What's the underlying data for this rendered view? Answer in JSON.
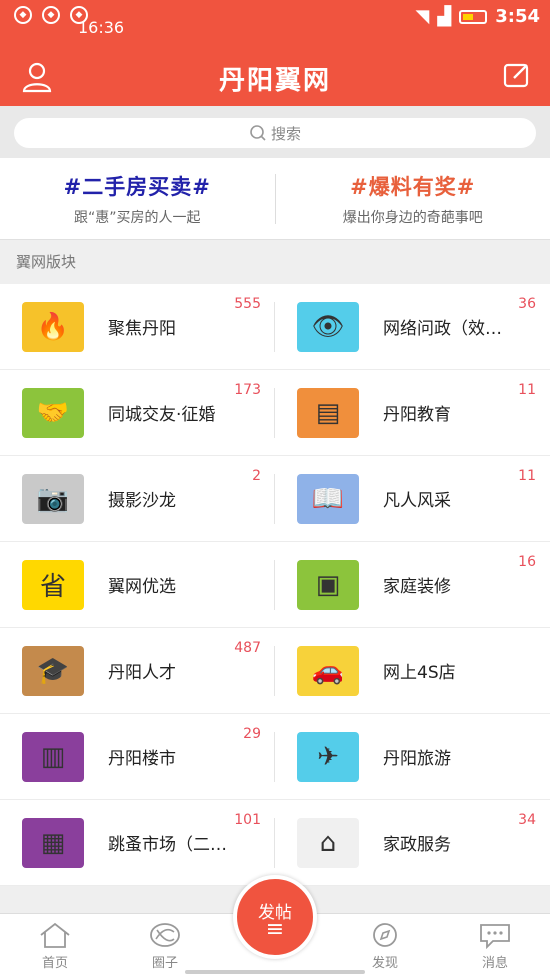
{
  "status_bar": {
    "time_left": "16:36",
    "time_right": "3:54"
  },
  "header": {
    "title": "丹阳翼网"
  },
  "search": {
    "placeholder": "搜索"
  },
  "topics": [
    {
      "title": "#二手房买卖#",
      "subtitle": "跟“惠”买房的人一起",
      "color": "#2222aa"
    },
    {
      "title": "#爆料有奖#",
      "subtitle": "爆出你身边的奇葩事吧",
      "color": "#e8603c"
    }
  ],
  "section_label": "翼网版块",
  "boards": [
    {
      "name": "聚焦丹阳",
      "count": "555",
      "icon": "phoenix-icon",
      "bg": "#f6c22a"
    },
    {
      "name": "网络问政（效…",
      "count": "36",
      "icon": "eye-icon",
      "bg": "#54cdea"
    },
    {
      "name": "同城交友·征婚",
      "count": "173",
      "icon": "handshake-heart-icon",
      "bg": "#8cc43c"
    },
    {
      "name": "丹阳教育",
      "count": "11",
      "icon": "blackboard-icon",
      "bg": "#f08f3c"
    },
    {
      "name": "摄影沙龙",
      "count": "2",
      "icon": "camera-icon",
      "bg": "#c9c9c9"
    },
    {
      "name": "凡人风采",
      "count": "11",
      "icon": "book-icon",
      "bg": "#8fb2e8"
    },
    {
      "name": "翼网优选",
      "count": "",
      "icon": "logo-badge-icon",
      "bg": "#ffd800"
    },
    {
      "name": "家庭装修",
      "count": "16",
      "icon": "paint-bucket-icon",
      "bg": "#8cc43c"
    },
    {
      "name": "丹阳人才",
      "count": "487",
      "icon": "graduation-cap-icon",
      "bg": "#c48a4c"
    },
    {
      "name": "网上4S店",
      "count": "",
      "icon": "car-icon",
      "bg": "#f7d23a"
    },
    {
      "name": "丹阳楼市",
      "count": "29",
      "icon": "building-icon",
      "bg": "#8a3f9c"
    },
    {
      "name": "丹阳旅游",
      "count": "",
      "icon": "airplane-icon",
      "bg": "#54cdea"
    },
    {
      "name": "跳蚤市场（二…",
      "count": "101",
      "icon": "shopping-bags-icon",
      "bg": "#8a3f9c"
    },
    {
      "name": "家政服务",
      "count": "34",
      "icon": "broom-icon",
      "bg": "#f0f0f0"
    }
  ],
  "tabs": [
    {
      "label": "首页",
      "icon": "home-icon"
    },
    {
      "label": "圈子",
      "icon": "circle-icon"
    },
    {
      "label": "发现",
      "icon": "compass-icon"
    },
    {
      "label": "消息",
      "icon": "message-icon"
    }
  ],
  "post_button": {
    "label": "发帖"
  }
}
